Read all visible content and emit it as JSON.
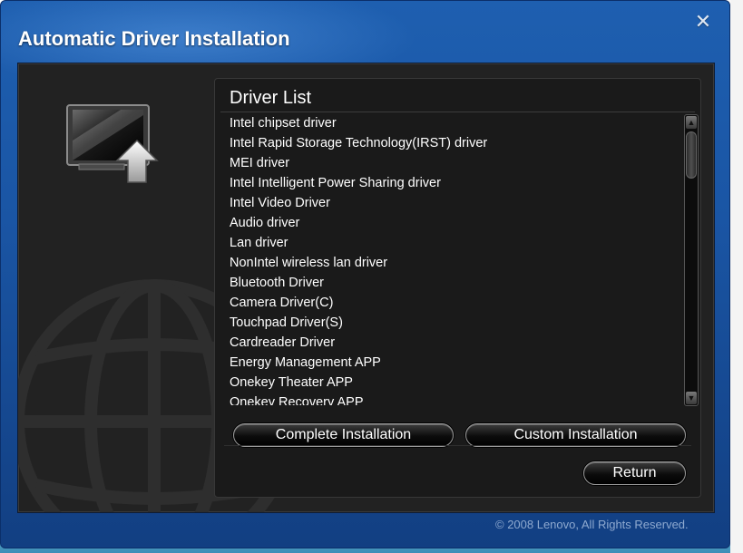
{
  "window": {
    "title": "Automatic Driver Installation",
    "close_glyph": "✕",
    "footer": "© 2008 Lenovo, All Rights Reserved."
  },
  "panel": {
    "title": "Driver List",
    "drivers": [
      "Intel chipset driver",
      "Intel Rapid Storage Technology(IRST) driver",
      "MEI driver",
      "Intel Intelligent Power Sharing driver",
      "Intel Video Driver",
      "Audio driver",
      "Lan driver",
      "NonIntel wireless lan driver",
      "Bluetooth Driver",
      "Camera Driver(C)",
      "Touchpad Driver(S)",
      "Cardreader Driver",
      "Energy Management APP",
      "Onekey Theater APP",
      "Onekey Recovery APP"
    ]
  },
  "buttons": {
    "complete": "Complete Installation",
    "custom": "Custom Installation",
    "return": "Return"
  },
  "icons": {
    "app": "monitor-upload-icon",
    "background": "globe-icon",
    "scroll_up": "scroll-up-arrow-icon",
    "scroll_down": "scroll-down-arrow-icon"
  }
}
